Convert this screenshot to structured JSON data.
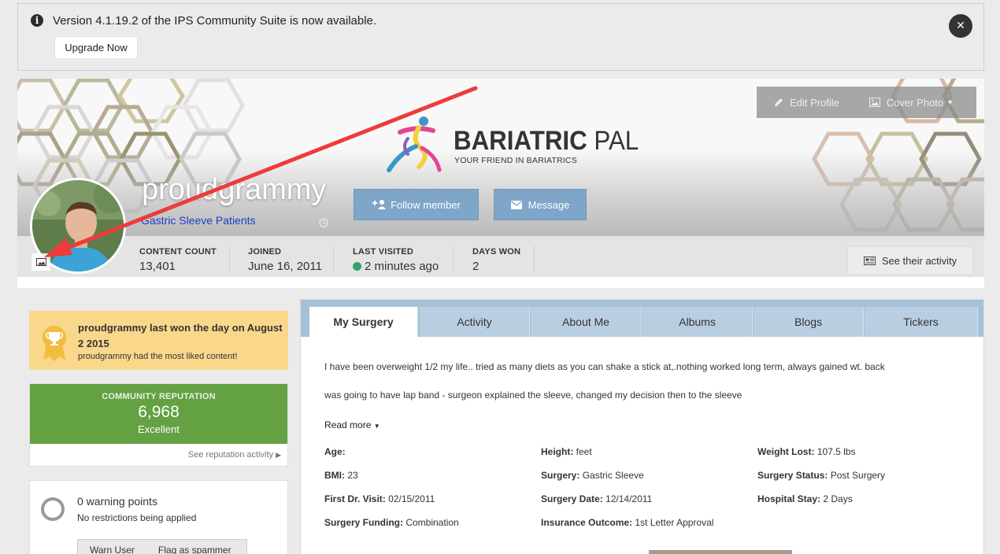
{
  "banner": {
    "message": "Version 4.1.19.2 of the IPS Community Suite is now available.",
    "upgrade_label": "Upgrade Now",
    "close_label": "✕"
  },
  "profile": {
    "logo_word_bold": "BARIATRIC",
    "logo_word_light": " PAL",
    "logo_tagline": "YOUR FRIEND IN BARIATRICS",
    "edit_label": "Edit Profile",
    "cover_label": "Cover Photo",
    "username": "proudgrammy",
    "group": "Gastric Sleeve Patients",
    "follow_label": "Follow member",
    "message_label": "Message",
    "see_activity_label": "See their activity"
  },
  "stats": [
    {
      "label": "CONTENT COUNT",
      "value": "13,401"
    },
    {
      "label": "JOINED",
      "value": "June 16, 2011"
    },
    {
      "label": "LAST VISITED",
      "value": "2 minutes ago"
    },
    {
      "label": "DAYS WON",
      "value": "2"
    }
  ],
  "award": {
    "title": "proudgrammy last won the day on August 2 2015",
    "subtitle": "proudgrammy had the most liked content!"
  },
  "reputation": {
    "heading": "COMMUNITY REPUTATION",
    "value": "6,968",
    "level": "Excellent",
    "link": "See reputation activity"
  },
  "warnings": {
    "points": "0 warning points",
    "restrictions": "No restrictions being applied",
    "warn_label": "Warn User",
    "flag_label": "Flag as spammer"
  },
  "tabs": [
    "My Surgery",
    "Activity",
    "About Me",
    "Albums",
    "Blogs",
    "Tickers"
  ],
  "surgery": {
    "para1": "I have been overweight 1/2 my life.. tried as many diets as you can shake a stick at,.nothing worked long term, always gained wt. back",
    "para2": "was going to have lap band - surgeon explained the sleeve, changed my decision then to the sleeve",
    "read_more": "Read more",
    "fields": [
      {
        "label": "Age:",
        "value": ""
      },
      {
        "label": "Height:",
        "value": " feet"
      },
      {
        "label": "Weight Lost:",
        "value": " 107.5 lbs"
      },
      {
        "label": "BMI:",
        "value": " 23"
      },
      {
        "label": "Surgery:",
        "value": " Gastric Sleeve"
      },
      {
        "label": "Surgery Status:",
        "value": " Post Surgery"
      },
      {
        "label": "First Dr. Visit:",
        "value": " 02/15/2011"
      },
      {
        "label": "Surgery Date:",
        "value": " 12/14/2011"
      },
      {
        "label": "Hospital Stay:",
        "value": " 2 Days"
      },
      {
        "label": "Surgery Funding:",
        "value": " Combination"
      },
      {
        "label": "Insurance Outcome:",
        "value": " 1st Letter Approval"
      }
    ]
  },
  "colors": {
    "accent_blue": "#7ea6c9",
    "reputation_green": "#63a142",
    "award_yellow": "#f9d88c",
    "online_dot": "#30a46c",
    "annotation_red": "#ee3b3b"
  }
}
